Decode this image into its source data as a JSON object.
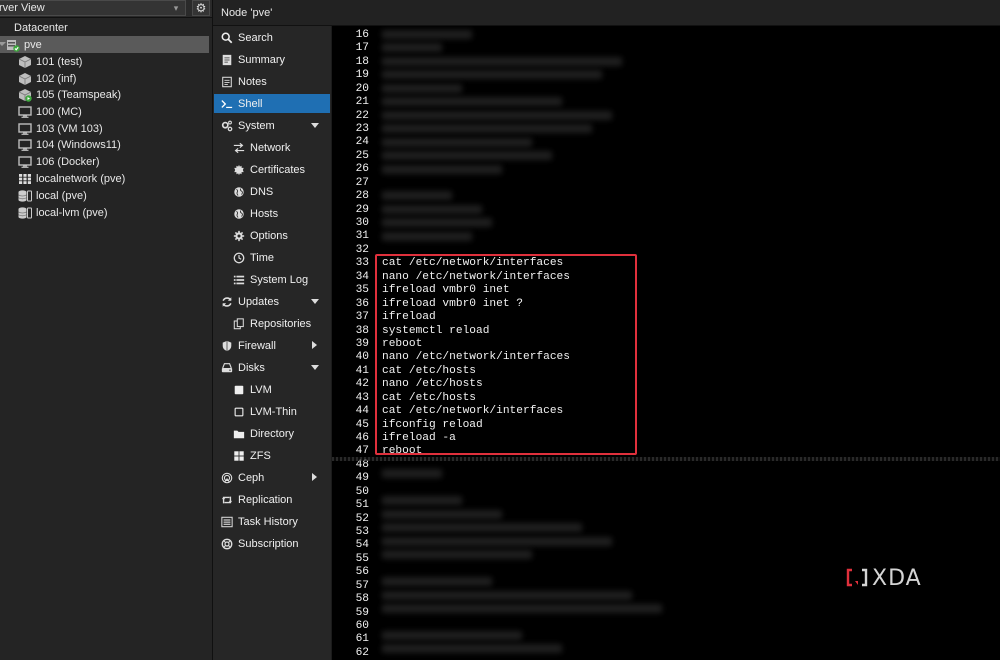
{
  "tree": {
    "view_label": "rver View",
    "items": [
      {
        "label": "Datacenter",
        "icon": "datacenter-icon"
      },
      {
        "label": "pve",
        "icon": "node-online-icon"
      },
      {
        "label": "101 (test)",
        "icon": "container-icon"
      },
      {
        "label": "102 (inf)",
        "icon": "container-icon"
      },
      {
        "label": "105 (Teamspeak)",
        "icon": "container-running-icon"
      },
      {
        "label": "100 (MC)",
        "icon": "vm-monitor-icon"
      },
      {
        "label": "103 (VM 103)",
        "icon": "vm-monitor-icon"
      },
      {
        "label": "104 (Windows11)",
        "icon": "vm-monitor-icon"
      },
      {
        "label": "106 (Docker)",
        "icon": "vm-monitor-icon"
      },
      {
        "label": "localnetwork (pve)",
        "icon": "sdn-grid-icon"
      },
      {
        "label": "local (pve)",
        "icon": "storage-icon"
      },
      {
        "label": "local-lvm (pve)",
        "icon": "storage-icon"
      }
    ]
  },
  "topbar": {
    "title": "Node 'pve'"
  },
  "menu": {
    "items": [
      {
        "label": "Search",
        "icon": "search-icon",
        "sub": false
      },
      {
        "label": "Summary",
        "icon": "summary-icon",
        "sub": false
      },
      {
        "label": "Notes",
        "icon": "notes-icon",
        "sub": false
      },
      {
        "label": "Shell",
        "icon": "terminal-icon",
        "sub": false,
        "active": true
      },
      {
        "label": "System",
        "icon": "cogs-icon",
        "sub": false,
        "expander": "down"
      },
      {
        "label": "Network",
        "icon": "network-icon",
        "sub": true
      },
      {
        "label": "Certificates",
        "icon": "certificate-icon",
        "sub": true
      },
      {
        "label": "DNS",
        "icon": "globe-icon",
        "sub": true
      },
      {
        "label": "Hosts",
        "icon": "globe-icon",
        "sub": true
      },
      {
        "label": "Options",
        "icon": "gear-icon",
        "sub": true
      },
      {
        "label": "Time",
        "icon": "clock-icon",
        "sub": true
      },
      {
        "label": "System Log",
        "icon": "list-icon",
        "sub": true
      },
      {
        "label": "Updates",
        "icon": "refresh-icon",
        "sub": false,
        "expander": "down"
      },
      {
        "label": "Repositories",
        "icon": "copy-icon",
        "sub": true
      },
      {
        "label": "Firewall",
        "icon": "shield-icon",
        "sub": false,
        "expander": "right"
      },
      {
        "label": "Disks",
        "icon": "hdd-icon",
        "sub": false,
        "expander": "down"
      },
      {
        "label": "LVM",
        "icon": "square-filled-icon",
        "sub": true
      },
      {
        "label": "LVM-Thin",
        "icon": "square-outline-icon",
        "sub": true
      },
      {
        "label": "Directory",
        "icon": "folder-icon",
        "sub": true
      },
      {
        "label": "ZFS",
        "icon": "th-large-icon",
        "sub": true
      },
      {
        "label": "Ceph",
        "icon": "ceph-icon",
        "sub": false,
        "expander": "right"
      },
      {
        "label": "Replication",
        "icon": "retweet-icon",
        "sub": false
      },
      {
        "label": "Task History",
        "icon": "list-alt-icon",
        "sub": false
      },
      {
        "label": "Subscription",
        "icon": "support-icon",
        "sub": false
      }
    ]
  },
  "terminal": {
    "lines": [
      {
        "n": "16",
        "cmd": ""
      },
      {
        "n": "17",
        "cmd": ""
      },
      {
        "n": "18",
        "cmd": ""
      },
      {
        "n": "19",
        "cmd": ""
      },
      {
        "n": "20",
        "cmd": ""
      },
      {
        "n": "21",
        "cmd": ""
      },
      {
        "n": "22",
        "cmd": ""
      },
      {
        "n": "23",
        "cmd": ""
      },
      {
        "n": "24",
        "cmd": ""
      },
      {
        "n": "25",
        "cmd": ""
      },
      {
        "n": "26",
        "cmd": ""
      },
      {
        "n": "27",
        "cmd": ""
      },
      {
        "n": "28",
        "cmd": ""
      },
      {
        "n": "29",
        "cmd": ""
      },
      {
        "n": "30",
        "cmd": ""
      },
      {
        "n": "31",
        "cmd": ""
      },
      {
        "n": "32",
        "cmd": ""
      },
      {
        "n": "33",
        "cmd": "cat /etc/network/interfaces"
      },
      {
        "n": "34",
        "cmd": "nano /etc/network/interfaces"
      },
      {
        "n": "35",
        "cmd": "ifreload vmbr0 inet"
      },
      {
        "n": "36",
        "cmd": "ifreload vmbr0 inet ?"
      },
      {
        "n": "37",
        "cmd": "ifreload"
      },
      {
        "n": "38",
        "cmd": "systemctl reload"
      },
      {
        "n": "39",
        "cmd": "reboot"
      },
      {
        "n": "40",
        "cmd": "nano /etc/network/interfaces"
      },
      {
        "n": "41",
        "cmd": "cat /etc/hosts"
      },
      {
        "n": "42",
        "cmd": "nano /etc/hosts"
      },
      {
        "n": "43",
        "cmd": "cat /etc/hosts"
      },
      {
        "n": "44",
        "cmd": "cat /etc/network/interfaces"
      },
      {
        "n": "45",
        "cmd": "ifconfig reload"
      },
      {
        "n": "46",
        "cmd": "ifreload -a"
      },
      {
        "n": "47",
        "cmd": "reboot"
      },
      {
        "n": "48",
        "cmd": ""
      },
      {
        "n": "49",
        "cmd": ""
      },
      {
        "n": "50",
        "cmd": ""
      },
      {
        "n": "51",
        "cmd": ""
      },
      {
        "n": "52",
        "cmd": ""
      },
      {
        "n": "53",
        "cmd": ""
      },
      {
        "n": "54",
        "cmd": ""
      },
      {
        "n": "55",
        "cmd": ""
      },
      {
        "n": "56",
        "cmd": ""
      },
      {
        "n": "57",
        "cmd": ""
      },
      {
        "n": "58",
        "cmd": ""
      },
      {
        "n": "59",
        "cmd": ""
      },
      {
        "n": "60",
        "cmd": ""
      },
      {
        "n": "61",
        "cmd": ""
      },
      {
        "n": "62",
        "cmd": ""
      }
    ]
  },
  "watermark": {
    "text": "XDA"
  },
  "colors": {
    "accent": "#1f6fb3",
    "highlight": "#e0303c",
    "online": "#3ea83e"
  }
}
